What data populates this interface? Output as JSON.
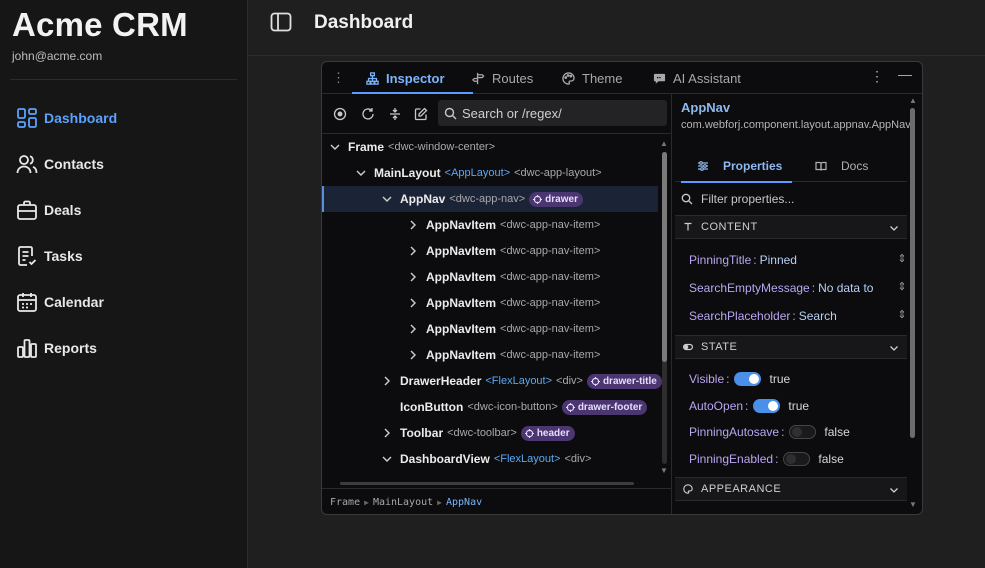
{
  "sidebar": {
    "brand": "Acme CRM",
    "email": "john@acme.com",
    "items": [
      {
        "label": "Dashboard",
        "icon": "dashboard-icon",
        "active": true
      },
      {
        "label": "Contacts",
        "icon": "users-icon"
      },
      {
        "label": "Deals",
        "icon": "briefcase-icon"
      },
      {
        "label": "Tasks",
        "icon": "checklist-icon"
      },
      {
        "label": "Calendar",
        "icon": "calendar-icon"
      },
      {
        "label": "Reports",
        "icon": "bar-chart-icon"
      }
    ]
  },
  "header": {
    "title": "Dashboard"
  },
  "inspector": {
    "tabs": [
      {
        "label": "Inspector",
        "icon": "hierarchy-icon",
        "active": true
      },
      {
        "label": "Routes",
        "icon": "route-icon"
      },
      {
        "label": "Theme",
        "icon": "palette-icon"
      },
      {
        "label": "AI Assistant",
        "icon": "chat-icon"
      }
    ],
    "tree": {
      "search_placeholder": "Search or /regex/",
      "rows": [
        {
          "name": "Frame",
          "tag": "<dwc-window-center>",
          "comp": "",
          "slot": "",
          "expand": "open"
        },
        {
          "name": "MainLayout",
          "comp": "<AppLayout>",
          "tag": "<dwc-app-layout>",
          "slot": "",
          "expand": "open"
        },
        {
          "name": "AppNav",
          "comp": "",
          "tag": "<dwc-app-nav>",
          "slot": "drawer",
          "expand": "open",
          "selected": true
        },
        {
          "name": "AppNavItem",
          "comp": "",
          "tag": "<dwc-app-nav-item>",
          "slot": "",
          "expand": "closed"
        },
        {
          "name": "AppNavItem",
          "comp": "",
          "tag": "<dwc-app-nav-item>",
          "slot": "",
          "expand": "closed"
        },
        {
          "name": "AppNavItem",
          "comp": "",
          "tag": "<dwc-app-nav-item>",
          "slot": "",
          "expand": "closed"
        },
        {
          "name": "AppNavItem",
          "comp": "",
          "tag": "<dwc-app-nav-item>",
          "slot": "",
          "expand": "closed"
        },
        {
          "name": "AppNavItem",
          "comp": "",
          "tag": "<dwc-app-nav-item>",
          "slot": "",
          "expand": "closed"
        },
        {
          "name": "AppNavItem",
          "comp": "",
          "tag": "<dwc-app-nav-item>",
          "slot": "",
          "expand": "closed"
        },
        {
          "name": "DrawerHeader",
          "comp": "<FlexLayout>",
          "tag": "<div>",
          "slot": "drawer-title",
          "expand": "closed"
        },
        {
          "name": "IconButton",
          "comp": "",
          "tag": "<dwc-icon-button>",
          "slot": "drawer-footer",
          "expand": "none"
        },
        {
          "name": "Toolbar",
          "comp": "",
          "tag": "<dwc-toolbar>",
          "slot": "header",
          "expand": "closed"
        },
        {
          "name": "DashboardView",
          "comp": "<FlexLayout>",
          "tag": "<div>",
          "slot": "",
          "expand": "open"
        }
      ]
    },
    "breadcrumb": [
      "Frame",
      "MainLayout",
      "AppNav"
    ],
    "selected": {
      "name": "AppNav",
      "class_name": "com.webforj.component.layout.appnav.AppNav"
    },
    "props_tabs": {
      "properties": "Properties",
      "docs": "Docs"
    },
    "filter_placeholder": "Filter properties...",
    "sections": {
      "content": "CONTENT",
      "state": "STATE",
      "appearance": "APPEARANCE"
    },
    "content_props": [
      {
        "key": "PinningTitle",
        "value": "Pinned"
      },
      {
        "key": "SearchEmptyMessage",
        "value": "No data to"
      },
      {
        "key": "SearchPlaceholder",
        "value": "Search"
      }
    ],
    "state_props": [
      {
        "key": "Visible",
        "value": "true",
        "on": true
      },
      {
        "key": "AutoOpen",
        "value": "true",
        "on": true
      },
      {
        "key": "PinningAutosave",
        "value": "false",
        "on": false
      },
      {
        "key": "PinningEnabled",
        "value": "false",
        "on": false
      }
    ]
  }
}
